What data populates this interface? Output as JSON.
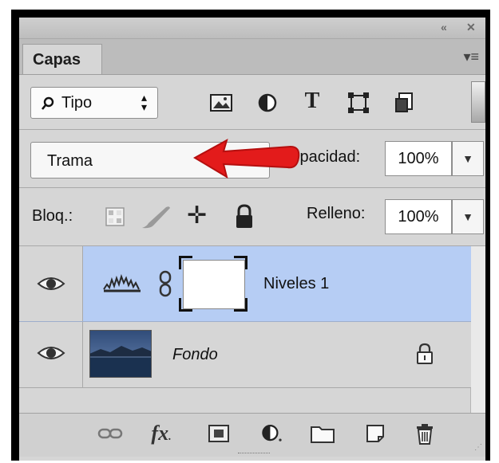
{
  "panel": {
    "tab_label": "Capas",
    "collapse_icon": "double-chevron-left-icon",
    "close_icon": "close-icon",
    "menu_icon": "panel-menu-icon"
  },
  "filter": {
    "search_icon": "search-icon",
    "kind_value": "Tipo",
    "kind_stepper_icon": "up-down-stepper-icon",
    "filter_icons": [
      "image-filter-icon",
      "adjustment-filter-icon",
      "type-filter-icon",
      "shape-filter-icon",
      "smart-object-filter-icon"
    ]
  },
  "blend": {
    "mode_value": "Trama",
    "opacity_label": "Opacidad:",
    "opacity_value": "100%"
  },
  "lock": {
    "label": "Bloq.:",
    "icons": [
      "lock-transparent-icon",
      "lock-image-icon",
      "lock-position-icon",
      "lock-all-icon"
    ],
    "fill_label": "Relleno:",
    "fill_value": "100%"
  },
  "layers": [
    {
      "name": "Niveles 1",
      "selected": true,
      "type": "adjustment-levels"
    },
    {
      "name": "Fondo",
      "selected": false,
      "locked": true
    }
  ],
  "footer_icons": [
    "link-layers-icon",
    "fx-icon",
    "layer-mask-icon",
    "new-adjustment-icon",
    "new-group-icon",
    "new-layer-icon",
    "trash-icon"
  ],
  "footer_fx_label": "fx",
  "colors": {
    "selected_row": "#b6cdf4",
    "annotation_arrow": "#e31b1b"
  }
}
